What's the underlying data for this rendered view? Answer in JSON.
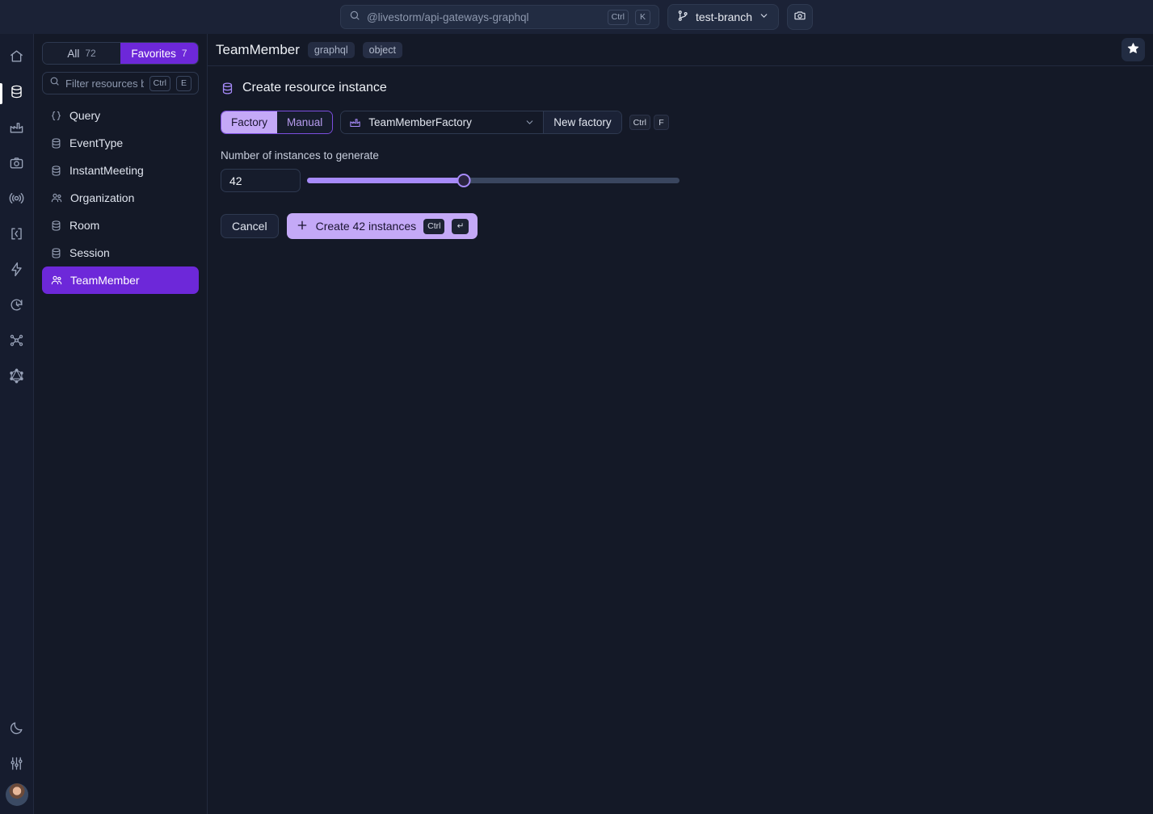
{
  "topbar": {
    "search": {
      "placeholder": "@livestorm/api-gateways-graphql",
      "kbd1": "Ctrl",
      "kbd2": "K"
    },
    "branch": {
      "label": "test-branch",
      "icon": "git-branch-icon",
      "chevron": "chevron-down-icon"
    },
    "screenshot_button": {
      "icon": "camera-icon"
    }
  },
  "rail": {
    "items": [
      {
        "name": "home",
        "icon": "home-icon"
      },
      {
        "name": "database",
        "icon": "database-icon",
        "active": true
      },
      {
        "name": "factories",
        "icon": "factory-icon"
      },
      {
        "name": "snapshots",
        "icon": "camera-icon"
      },
      {
        "name": "broadcast",
        "icon": "broadcast-icon"
      },
      {
        "name": "code",
        "icon": "code-brackets-icon"
      },
      {
        "name": "actions",
        "icon": "lightning-icon"
      },
      {
        "name": "history",
        "icon": "history-icon"
      },
      {
        "name": "graph",
        "icon": "network-graph-icon"
      },
      {
        "name": "graphql",
        "icon": "graphql-icon"
      }
    ],
    "bottom": [
      {
        "name": "theme",
        "icon": "moon-icon"
      },
      {
        "name": "settings",
        "icon": "sliders-icon"
      },
      {
        "name": "profile",
        "icon": "avatar"
      }
    ]
  },
  "resources": {
    "tabs": [
      {
        "label": "All",
        "count": "72",
        "active": false
      },
      {
        "label": "Favorites",
        "count": "7",
        "active": true
      }
    ],
    "filter": {
      "placeholder": "Filter resources by…",
      "kbd1": "Ctrl",
      "kbd2": "E"
    },
    "items": [
      {
        "label": "Query",
        "icon": "braces-icon",
        "active": false
      },
      {
        "label": "EventType",
        "icon": "database-icon",
        "active": false
      },
      {
        "label": "InstantMeeting",
        "icon": "database-icon",
        "active": false
      },
      {
        "label": "Organization",
        "icon": "users-icon",
        "active": false
      },
      {
        "label": "Room",
        "icon": "database-icon",
        "active": false
      },
      {
        "label": "Session",
        "icon": "database-icon",
        "active": false
      },
      {
        "label": "TeamMember",
        "icon": "users-icon",
        "active": true
      }
    ]
  },
  "main": {
    "title": "TeamMember",
    "badges": [
      "graphql",
      "object"
    ],
    "favorite_button": {
      "icon": "star-icon"
    },
    "section_title": "Create resource instance",
    "section_icon": "database-icon",
    "mode_toggle": {
      "options": [
        "Factory",
        "Manual"
      ],
      "selected": "Factory"
    },
    "factory_select": {
      "value": "TeamMemberFactory",
      "icon": "factory-icon"
    },
    "new_factory": {
      "label": "New factory",
      "kbd1": "Ctrl",
      "kbd2": "F"
    },
    "instances": {
      "label": "Number of instances to generate",
      "value": "42",
      "slider_percent": 42,
      "min": 1,
      "max": 100
    },
    "cancel_label": "Cancel",
    "create_label": "Create 42 instances",
    "create_kbd1": "Ctrl",
    "create_kbd2": "↵"
  },
  "colors": {
    "accent": "#6d28d9",
    "accent_light": "#c4a9f7",
    "accent_mid": "#a78bfa",
    "bg": "#141927",
    "bg_topbar": "#1b2236",
    "bg_rail": "#161c2e"
  }
}
